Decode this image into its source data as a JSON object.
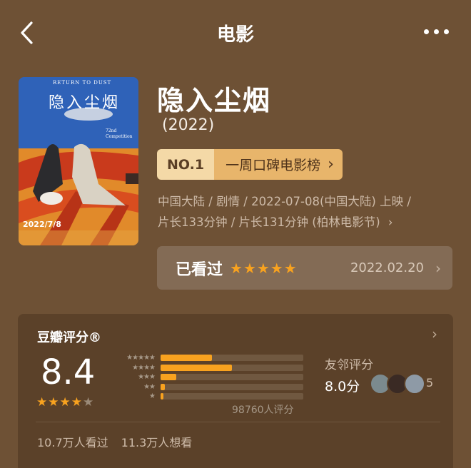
{
  "nav": {
    "title": "电影",
    "back_icon": "chevron-left-icon",
    "more_icon": "more-dots-icon"
  },
  "poster": {
    "en_title": "RETURN TO DUST",
    "cn_title": "隐入尘烟",
    "festival": "72nd Competition",
    "release_text": "2022/7/8"
  },
  "movie": {
    "title": "隐入尘烟",
    "year": "(2022)",
    "rank_badge": "NO.1",
    "rank_list": "一周口碑电影榜",
    "rank_chevron": "›",
    "info_line1": "中国大陆 / 剧情 / 2022-07-08(中国大陆) 上映 /",
    "info_line2": "片长133分钟 / 片长131分钟 (柏林电影节)",
    "info_chevron": "›"
  },
  "my_rating": {
    "label": "已看过",
    "stars": "★★★★★",
    "date": "2022.02.20",
    "chevron": "›",
    "star_color": "#f8a21f"
  },
  "douban": {
    "title": "豆瓣评分®",
    "chevron": "›",
    "score": "8.4",
    "stars_full": "★★★★",
    "stars_empty": "★",
    "distribution": [
      {
        "stars": "★★★★★",
        "fraction": 0.36
      },
      {
        "stars": "★★★★",
        "fraction": 0.5
      },
      {
        "stars": "★★★",
        "fraction": 0.11
      },
      {
        "stars": "★★",
        "fraction": 0.03
      },
      {
        "stars": "★",
        "fraction": 0.02
      }
    ],
    "votes": "98760人评分",
    "neighbor_label": "友邻评分",
    "neighbor_score": "8.0分",
    "neighbor_count": "5",
    "watched": "10.7万人看过",
    "wish": "11.3万人想看"
  }
}
